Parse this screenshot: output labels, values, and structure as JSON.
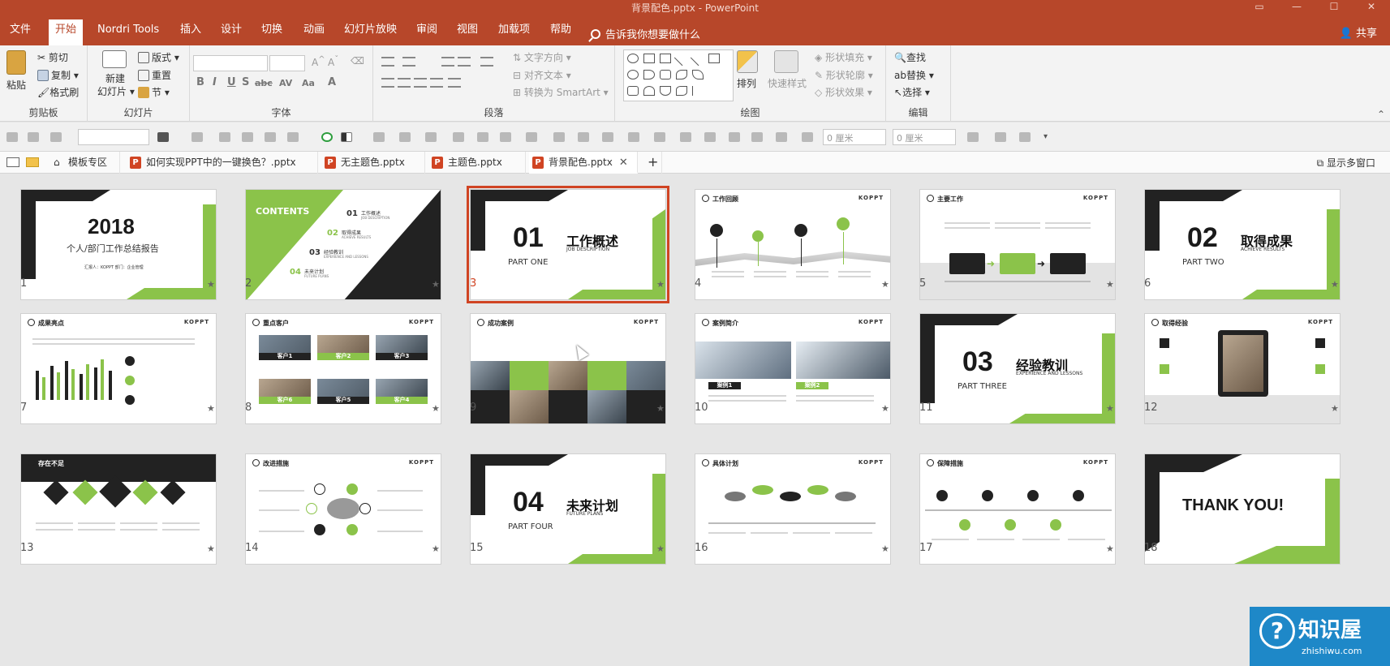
{
  "window": {
    "title": "背景配色.pptx  -  PowerPoint",
    "buttons": [
      "▭",
      "—",
      "☐",
      "✕"
    ]
  },
  "ribbon_tabs": [
    "文件",
    "开始",
    "Nordri Tools",
    "插入",
    "设计",
    "切换",
    "动画",
    "幻灯片放映",
    "审阅",
    "视图",
    "加载项",
    "帮助"
  ],
  "active_tab": "开始",
  "tell_me": "告诉我你想要做什么",
  "share": "共享",
  "groups": {
    "clipboard": {
      "label": "剪贴板",
      "paste": "粘贴",
      "cut": "剪切",
      "copy": "复制",
      "format_painter": "格式刷"
    },
    "slides": {
      "label": "幻灯片",
      "new_slide": "新建",
      "new_slide2": "幻灯片",
      "layout": "版式",
      "reset": "重置",
      "section": "节"
    },
    "font": {
      "label": "字体"
    },
    "paragraph": {
      "label": "段落",
      "text_direction": "文字方向",
      "align_text": "对齐文本",
      "smartart": "转换为 SmartArt"
    },
    "drawing": {
      "label": "绘图",
      "arrange": "排列",
      "quick_styles": "快速样式",
      "shape_fill": "形状填充",
      "shape_outline": "形状轮廓",
      "shape_effects": "形状效果"
    },
    "editing": {
      "label": "编辑",
      "find": "查找",
      "replace": "替换",
      "select": "选择"
    }
  },
  "quick_toolbar": {
    "width_value": "0 厘米",
    "height_value": "0 厘米"
  },
  "file_tabs": {
    "template": "模板专区",
    "tabs": [
      "如何实现PPT中的一键换色？.pptx",
      "无主题色.pptx",
      "主题色.pptx",
      "背景配色.pptx"
    ],
    "active": "背景配色.pptx",
    "multi_window": "显示多窗口"
  },
  "slides": [
    {
      "n": "1",
      "big": "2018",
      "zh": "个人/部门工作总结报告",
      "sub": "汇报人：KOPPT    部门：企业管理"
    },
    {
      "n": "2",
      "title": "CONTENTS",
      "items": [
        "01",
        "工作概述",
        "02",
        "取得成果",
        "03",
        "经验教训",
        "04",
        "未来计划"
      ],
      "subs": [
        "JOB DESCRIPTION",
        "ACHIEVE RESULTS",
        "EXPERIENCE AND LESSONS",
        "FUTURE PLANS"
      ]
    },
    {
      "n": "3",
      "big": "01",
      "part": "PART ONE",
      "zh": "工作概述",
      "en": "JOB DESCRIPTION"
    },
    {
      "n": "4",
      "header": "工作回顾",
      "logo": "KOPPT"
    },
    {
      "n": "5",
      "header": "主要工作",
      "logo": "KOPPT"
    },
    {
      "n": "6",
      "big": "02",
      "part": "PART TWO",
      "zh": "取得成果",
      "en": "ACHIEVE RESULTS"
    },
    {
      "n": "7",
      "header": "成果亮点",
      "logo": "KOPPT"
    },
    {
      "n": "8",
      "header": "重点客户",
      "logo": "KOPPT",
      "clients": [
        "客户1",
        "客户2",
        "客户3",
        "客户6",
        "客户5",
        "客户4"
      ]
    },
    {
      "n": "9",
      "header": "成功案例",
      "logo": "KOPPT"
    },
    {
      "n": "10",
      "header": "案例简介",
      "logo": "KOPPT",
      "cases": [
        "案例1",
        "案例2"
      ]
    },
    {
      "n": "11",
      "big": "03",
      "part": "PART THREE",
      "zh": "经验教训",
      "en": "EXPERIENCE AND LESSONS"
    },
    {
      "n": "12",
      "header": "取得经验",
      "logo": "KOPPT"
    },
    {
      "n": "13",
      "header": "存在不足",
      "logo": ""
    },
    {
      "n": "14",
      "header": "改进措施",
      "logo": "KOPPT"
    },
    {
      "n": "15",
      "big": "04",
      "part": "PART FOUR",
      "zh": "未来计划",
      "en": "FUTURE PLANS"
    },
    {
      "n": "16",
      "header": "具体计划",
      "logo": "KOPPT"
    },
    {
      "n": "17",
      "header": "保障措施",
      "logo": "KOPPT"
    },
    {
      "n": "18",
      "thanks": "THANK YOU!"
    }
  ],
  "selected_slide": "3",
  "star": "★",
  "watermark": {
    "main": "知识屋",
    "sub": "zhishiwu.com"
  }
}
